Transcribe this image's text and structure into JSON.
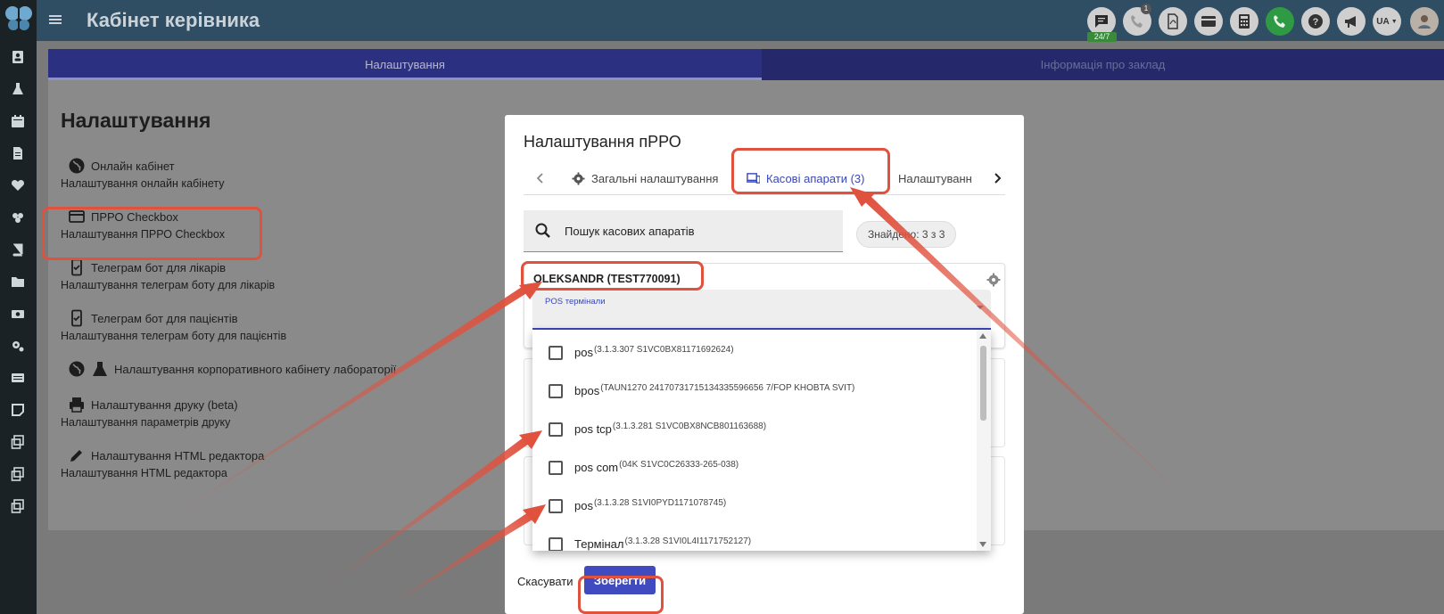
{
  "header": {
    "title": "Кабінет керівника",
    "badge": "24/7",
    "lang": "UA",
    "notif_count": "1"
  },
  "tabs": {
    "settings": "Налаштування",
    "info": "Інформація про заклад"
  },
  "settings_page": {
    "heading": "Налаштування",
    "options": [
      {
        "label": "Онлайн кабінет",
        "sub": "Налаштування онлайн кабінету"
      },
      {
        "label": "ПРРО Checkbox",
        "sub": "Налаштування ПРРО Checkbox"
      },
      {
        "label": "Телеграм бот для лікарів",
        "sub": "Налаштування телеграм боту для лікарів"
      },
      {
        "label": "Телеграм бот для пацієнтів",
        "sub": "Налаштування телеграм боту для пацієнтів"
      },
      {
        "label": "Налаштування корпоративного кабінету лабораторії",
        "sub": ""
      },
      {
        "label": "Налаштування друку (beta)",
        "sub": "Налаштування параметрів друку"
      },
      {
        "label": "Налаштування HTML редактора",
        "sub": "Налаштування HTML редактора"
      }
    ]
  },
  "modal": {
    "title": "Налаштування пРРО",
    "tabs": [
      "Загальні налаштування",
      "Касові апарати (3)",
      "Налаштуванн"
    ],
    "search_placeholder": "Пошук касових апаратів",
    "found": "Знайдено: 3 з 3",
    "register_name": "OLEKSANDR (TEST770091)",
    "pos_label": "POS термінали",
    "pos_items": [
      {
        "name": "pos",
        "detail": "(3.1.3.307 S1VC0BX81171692624)"
      },
      {
        "name": "bpos",
        "detail": "(TAUN1270 24170731715134335596656 7/FOP KHOBTA SVIT)"
      },
      {
        "name": "pos tcp",
        "detail": "(3.1.3.281 S1VC0BX8NCB801163688)"
      },
      {
        "name": "pos com",
        "detail": "(04K S1VC0C26333-265-038)"
      },
      {
        "name": "pos",
        "detail": "(3.1.3.28 S1VI0PYD1171078745)"
      },
      {
        "name": "Термінал",
        "detail": "(3.1.3.28 S1VI0L4I1171752127)"
      }
    ],
    "cancel": "Скасувати",
    "save": "Зберегти"
  },
  "colors": {
    "accent": "#3946b8",
    "highlight": "#e0513e",
    "topbar": "#304e63"
  }
}
